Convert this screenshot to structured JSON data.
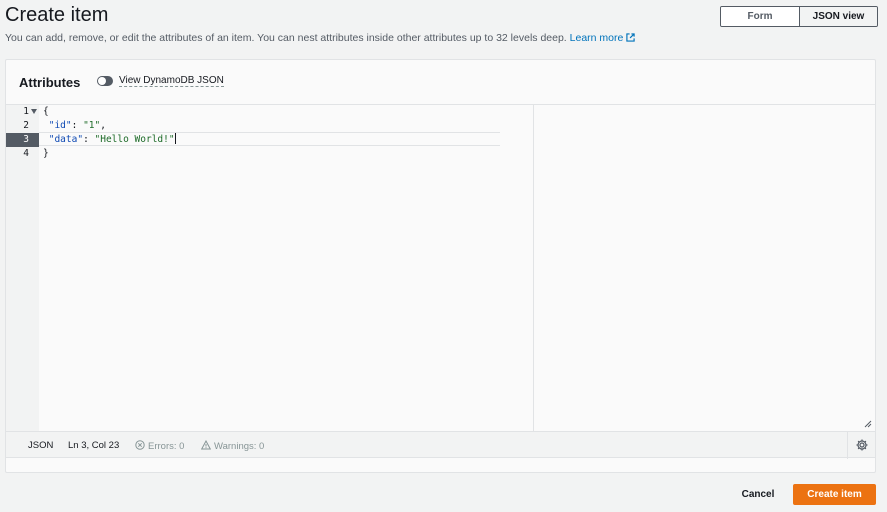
{
  "header": {
    "title": "Create item",
    "description": "You can add, remove, or edit the attributes of an item. You can nest attributes inside other attributes up to 32 levels deep.",
    "learn_more": "Learn more"
  },
  "view_toggle": {
    "form_label": "Form",
    "json_label": "JSON view",
    "selected": "JSON view"
  },
  "attributes": {
    "title": "Attributes",
    "dynamodb_json_label": "View DynamoDB JSON",
    "dynamodb_json_enabled": false
  },
  "editor": {
    "lines": [
      {
        "number": "1",
        "indent": "",
        "key": "",
        "sep": "",
        "value": "",
        "raw": "{"
      },
      {
        "number": "2",
        "indent": " ",
        "key": "\"id\"",
        "sep": ": ",
        "value": "\"1\"",
        "raw": ","
      },
      {
        "number": "3",
        "indent": " ",
        "key": "\"data\"",
        "sep": ": ",
        "value": "\"Hello World!\"",
        "raw": ""
      },
      {
        "number": "4",
        "indent": "",
        "key": "",
        "sep": "",
        "value": "",
        "raw": "}"
      }
    ],
    "active_line": 3
  },
  "status_bar": {
    "language": "JSON",
    "cursor": "Ln 3, Col 23",
    "errors": "Errors: 0",
    "warnings": "Warnings: 0"
  },
  "footer": {
    "cancel_label": "Cancel",
    "create_label": "Create item"
  },
  "colors": {
    "primary_button": "#ec7211",
    "link": "#0073bb",
    "json_key": "#0f4ab4",
    "json_string": "#1d6b28"
  },
  "icons": [
    "external-link-icon",
    "fold-arrow-icon",
    "error-circle-icon",
    "warning-triangle-icon",
    "settings-gear-icon",
    "resize-handle-icon"
  ]
}
